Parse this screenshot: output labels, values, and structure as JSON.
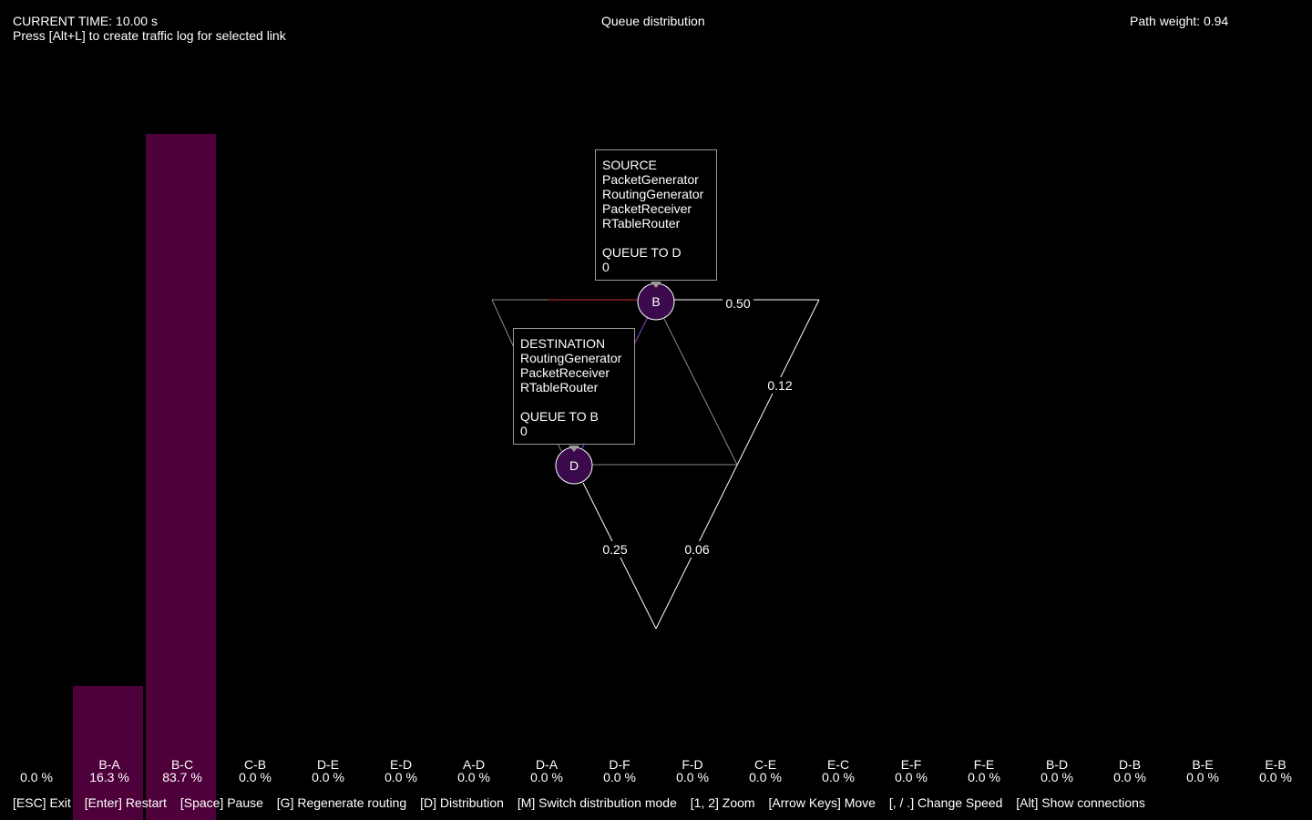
{
  "header": {
    "current_time": "CURRENT TIME: 10.00 s",
    "log_hint": "Press [Alt+L] to create traffic log for selected link",
    "mode_title": "Queue distribution",
    "path_weight": "Path weight: 0.94"
  },
  "colors": {
    "background": "#000000",
    "bar": "#4d0039",
    "node_fill": "#3a0a4c",
    "edge": "#ffffff",
    "edge_dim": "#8a8a8a",
    "edge_active": "#c03030",
    "edge_path": "#7a3fb0"
  },
  "distribution": [
    {
      "link": "",
      "percent": "0.0 %",
      "value": 0
    },
    {
      "link": "B-A",
      "percent": "16.3 %",
      "value": 16.3
    },
    {
      "link": "B-C",
      "percent": "83.7 %",
      "value": 83.7
    },
    {
      "link": "C-B",
      "percent": "0.0 %",
      "value": 0
    },
    {
      "link": "D-E",
      "percent": "0.0 %",
      "value": 0
    },
    {
      "link": "E-D",
      "percent": "0.0 %",
      "value": 0
    },
    {
      "link": "A-D",
      "percent": "0.0 %",
      "value": 0
    },
    {
      "link": "D-A",
      "percent": "0.0 %",
      "value": 0
    },
    {
      "link": "D-F",
      "percent": "0.0 %",
      "value": 0
    },
    {
      "link": "F-D",
      "percent": "0.0 %",
      "value": 0
    },
    {
      "link": "C-E",
      "percent": "0.0 %",
      "value": 0
    },
    {
      "link": "E-C",
      "percent": "0.0 %",
      "value": 0
    },
    {
      "link": "E-F",
      "percent": "0.0 %",
      "value": 0
    },
    {
      "link": "F-E",
      "percent": "0.0 %",
      "value": 0
    },
    {
      "link": "B-D",
      "percent": "0.0 %",
      "value": 0
    },
    {
      "link": "D-B",
      "percent": "0.0 %",
      "value": 0
    },
    {
      "link": "B-E",
      "percent": "0.0 %",
      "value": 0
    },
    {
      "link": "E-B",
      "percent": "0.0 %",
      "value": 0
    }
  ],
  "graph": {
    "nodes": [
      {
        "id": "B",
        "label": "B"
      },
      {
        "id": "D",
        "label": "D"
      }
    ],
    "edge_weights": [
      "0.50",
      "0.12",
      "0.25",
      "0.06"
    ]
  },
  "source_box": {
    "lines": [
      "SOURCE",
      "PacketGenerator",
      "RoutingGenerator",
      "PacketReceiver",
      "RTableRouter",
      "",
      "QUEUE TO D",
      "0"
    ]
  },
  "destination_box": {
    "lines": [
      "DESTINATION",
      "RoutingGenerator",
      "PacketReceiver",
      "RTableRouter",
      "",
      "QUEUE TO B",
      "0"
    ]
  },
  "footer": {
    "keys": [
      "[ESC] Exit",
      "[Enter] Restart",
      "[Space] Pause",
      "[G] Regenerate routing",
      "[D] Distribution",
      "[M] Switch distribution mode",
      "[1, 2] Zoom",
      "[Arrow Keys] Move",
      "[, / .] Change Speed",
      "[Alt] Show connections"
    ]
  }
}
